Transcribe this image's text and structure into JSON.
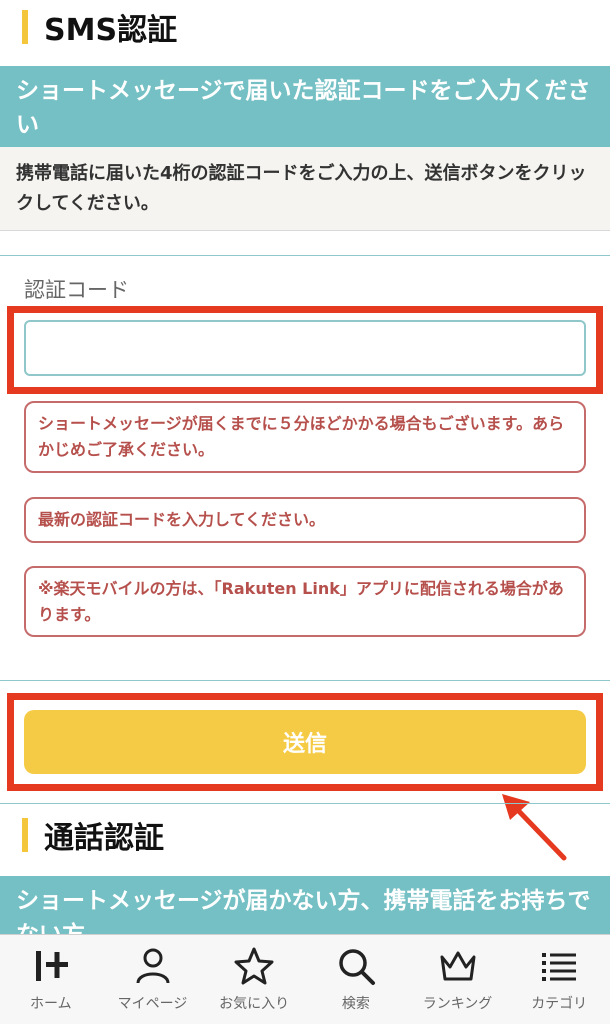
{
  "sms_section": {
    "title": "SMS認証",
    "banner": "ショートメッセージで届いた認証コードをご入力ください",
    "instruction": "携帯電話に届いた4桁の認証コードをご入力の上、送信ボタンをクリックしてください。",
    "code_label": "認証コード",
    "code_value": "",
    "notices": [
      "ショートメッセージが届くまでに５分ほどかかる場合もございます。あらかじめご了承ください。",
      "最新の認証コードを入力してください。",
      "※楽天モバイルの方は、「Rakuten Link」アプリに配信される場合があります。"
    ],
    "submit_label": "送信"
  },
  "call_section": {
    "title": "通話認証",
    "banner": "ショートメッセージが届かない方、携帯電話をお持ちでない方"
  },
  "bottom_nav": [
    {
      "label": "ホーム",
      "icon": "home-logo-icon"
    },
    {
      "label": "マイページ",
      "icon": "person-icon"
    },
    {
      "label": "お気に入り",
      "icon": "star-icon"
    },
    {
      "label": "検索",
      "icon": "search-icon"
    },
    {
      "label": "ランキング",
      "icon": "crown-icon"
    },
    {
      "label": "カテゴリ",
      "icon": "list-icon"
    }
  ],
  "colors": {
    "accent_yellow": "#f5cb46",
    "banner_teal": "#75c0c4",
    "highlight_red": "#e53920",
    "notice_red": "#b6504c"
  }
}
